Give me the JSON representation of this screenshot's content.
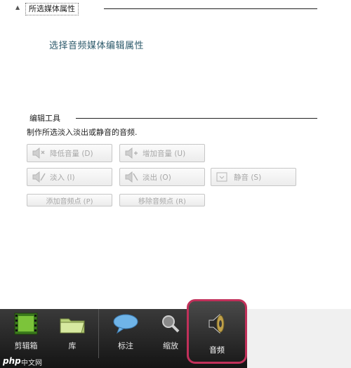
{
  "properties": {
    "header_title": "所选媒体属性",
    "body_text": "选择音频媒体编辑属性"
  },
  "edit_tools": {
    "title": "编辑工具",
    "description": "制作所选淡入淡出或静音的音频.",
    "buttons": {
      "lower_volume": "降低音量 (D)",
      "raise_volume": "增加音量 (U)",
      "fade_in": "淡入 (I)",
      "fade_out": "淡出 (O)",
      "mute": "静音 (S)",
      "add_audio_point": "添加音频点 (P)",
      "remove_audio_point": "移除音频点 (R)"
    }
  },
  "toolbar": {
    "items": [
      {
        "label": "剪辑箱",
        "icon": "film-icon"
      },
      {
        "label": "库",
        "icon": "folder-icon"
      },
      {
        "label": "标注",
        "icon": "speech-bubble-icon"
      },
      {
        "label": "缩放",
        "icon": "magnifier-icon"
      },
      {
        "label": "音频",
        "icon": "speaker-icon"
      }
    ]
  },
  "watermark": {
    "logo": "php",
    "text": "中文网"
  },
  "colors": {
    "highlight_border": "#c1305a",
    "body_text": "#2d5a6b",
    "disabled_text": "#a7a7a7"
  }
}
